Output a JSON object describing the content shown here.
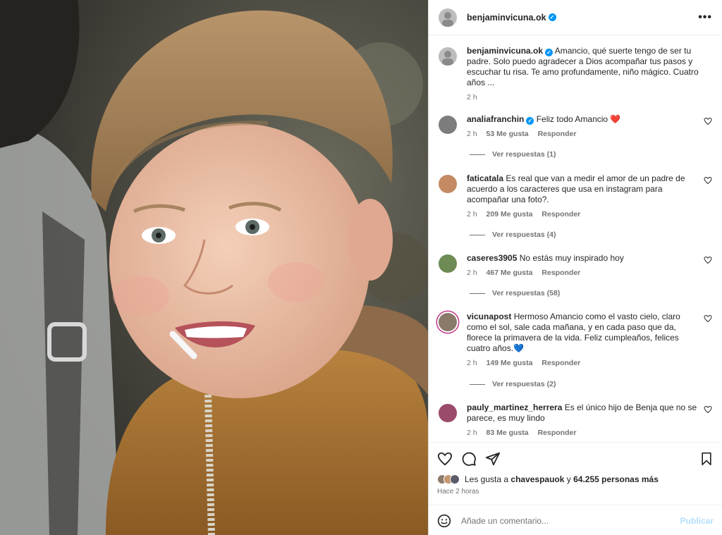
{
  "post": {
    "username": "benjaminvicuna.ok",
    "more_label": "•••"
  },
  "caption": {
    "username": "benjaminvicuna.ok",
    "text": "Amancio, qué suerte tengo de ser tu padre. Solo puedo agradecer a Dios acompañar tus pasos y escuchar tu risa. Te amo profundamente, niño mágico. Cuatro años ...",
    "time": "2 h"
  },
  "comments": [
    {
      "username": "analiafranchin",
      "verified": true,
      "text": "Feliz todo Amancio ❤️",
      "time": "2 h",
      "likes": "53 Me gusta",
      "reply": "Responder",
      "replies": "Ver respuestas (1)"
    },
    {
      "username": "faticatala",
      "verified": false,
      "text": "Es real que van a medir el amor de un padre de acuerdo a los caracteres que usa en instagram para acompañar una foto?.",
      "time": "2 h",
      "likes": "209 Me gusta",
      "reply": "Responder",
      "replies": "Ver respuestas (4)"
    },
    {
      "username": "caseres3905",
      "verified": false,
      "text": "No estás muy inspirado hoy",
      "time": "2 h",
      "likes": "467 Me gusta",
      "reply": "Responder",
      "replies": "Ver respuestas (58)"
    },
    {
      "username": "vicunapost",
      "verified": false,
      "text": "Hermoso Amancio como el vasto cielo, claro como el sol, sale cada mañana, y en cada paso que da, florece la primavera de la vida. Feliz cumpleaños, felices cuatro años.💙",
      "time": "2 h",
      "likes": "149 Me gusta",
      "reply": "Responder",
      "replies": "Ver respuestas (2)"
    },
    {
      "username": "pauly_martinez_herrera",
      "verified": false,
      "text": "Es el único hijo de Benja que no se parece, es muy lindo",
      "time": "2 h",
      "likes": "83 Me gusta",
      "reply": "Responder",
      "replies": ""
    }
  ],
  "likes_line": {
    "prefix": "Les gusta a",
    "user": "chavespauok",
    "joiner": "y",
    "others": "64.255 personas más"
  },
  "posted_time": "Hace 2 horas",
  "add_comment": {
    "placeholder": "Añade un comentario...",
    "publish": "Publicar"
  },
  "colors": {
    "verified": "#0095f6",
    "muted": "#737373",
    "publish_disabled": "#b2dffc"
  }
}
